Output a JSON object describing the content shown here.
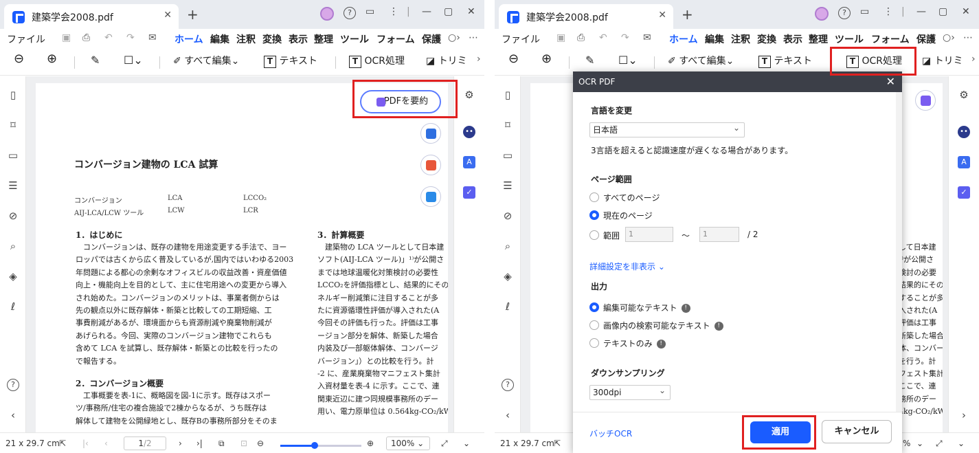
{
  "tab": {
    "title": "建築学会2008.pdf"
  },
  "menu": {
    "items": [
      "ファイル",
      "ホーム",
      "編集",
      "注釈",
      "変換",
      "表示",
      "整理",
      "ツール",
      "フォーム",
      "保護"
    ]
  },
  "toolbar": {
    "edit_all": "すべて編集",
    "text": "テキスト",
    "ocr": "OCR処理",
    "trim_left": "トリミ",
    "trim_right": "トリミ"
  },
  "summarize": {
    "label": "PDFを要約"
  },
  "document": {
    "title": "コンバージョン建物の LCA 試算",
    "meta_rows": [
      [
        "コンバージョン",
        "LCA",
        "LCCO₂"
      ],
      [
        "AIJ-LCA/LCW ツール",
        "LCW",
        "LCR"
      ]
    ],
    "sec1": "1．はじめに",
    "sec1_text": "　コンバージョンは、既存の建物を用途変更する手法で、ヨー\nロッパでは古くから広く普及しているが,国内ではいわゆる2003\n年問題による都心の余剰なオフィスビルの収益改善・資産価値\n向上・機能向上を目的として、主に住宅用途への変更から導入\nされ始めた。コンバージョンのメリットは、事業者側からは\n先の観点以外に既存解体・新築と比較しての工期短縮、工\n事費削減があるが、環境面からも資源削減や廃棄物削減が\nあげられる。今回、実際のコンバージョン建物でこれらも\n含めて LCA を試算し、既存解体・新築との比較を行ったの\nで報告する。",
    "sec2": "2．コンバージョン概要",
    "sec2_text": "　工事概要を表-1に、概略図を図-1に示す。既存はスポー\nツ/事務所/住宅の複合施設で2棟からなるが、うち既存は\n解体して建物を公開緑地とし、既存Bの事務所部分をそのま",
    "sec3": "3．計算概要",
    "sec3_text": "　建築物の LCA ツールとして日本建\nソフト(AIJ-LCA ツール)」¹⁾が公開さ\nまでは地球温暖化対策検討の必要性\nLCCO₂を評価指標とし、結果的にその\nネルギー削減策に注目することが多\nたに資源循環性評価が導入された(A\n今回その評価も行った。評価は工事\nージョン部分を解体、新築した場合\n内装及び一部躯体解体、コンバージ\nバージョン」）との比較を行う。計\n-2 に、産業廃棄物マニフェスト集計\n入資材量を表-4 に示す。ここで、連\n関東近辺に建つ同規模事務所のデー\n用い、電力原単位は 0.564kg-CO₂/kW",
    "right_text": "して日本建\n¹⁾が公開さ\n検討の必要\n結果的にその\nすることが多\n入された(A\n評価は工事\n新築した場合\n体、コンバージ\nを行う。計\nフェスト集計\nここで、連\n務所のデー\n4kg-CO₂/kW"
  },
  "statusbar": {
    "size": "21 x 29.7 cm",
    "page_current": "1",
    "page_total": "/2",
    "zoom": "100%",
    "zoom_right": "%"
  },
  "zoom_fraction": 0.42,
  "ocr_dialog": {
    "title": "OCR PDF",
    "language_label": "言語を変更",
    "language_value": "日本語",
    "language_note": "3言語を超えると認識速度が遅くなる場合があります。",
    "page_range_label": "ページ範囲",
    "all_pages": "すべてのページ",
    "current_page": "現在のページ",
    "range": "範囲",
    "range_from": "1",
    "range_to": "1",
    "range_tilde": "〜",
    "range_total": "/ 2",
    "advanced_toggle": "詳細設定を非表示",
    "output_label": "出力",
    "output_editable": "編集可能なテキスト",
    "output_searchable": "画像内の検索可能なテキスト",
    "output_text_only": "テキストのみ",
    "downsampling_label": "ダウンサンプリング",
    "downsampling_value": "300dpi",
    "batch_link": "バッチOCR",
    "apply": "適用",
    "cancel": "キャンセル"
  },
  "colors": {
    "accent": "#1a5cff",
    "highlight": "#e02020",
    "dialog_header": "#3c3f48"
  }
}
